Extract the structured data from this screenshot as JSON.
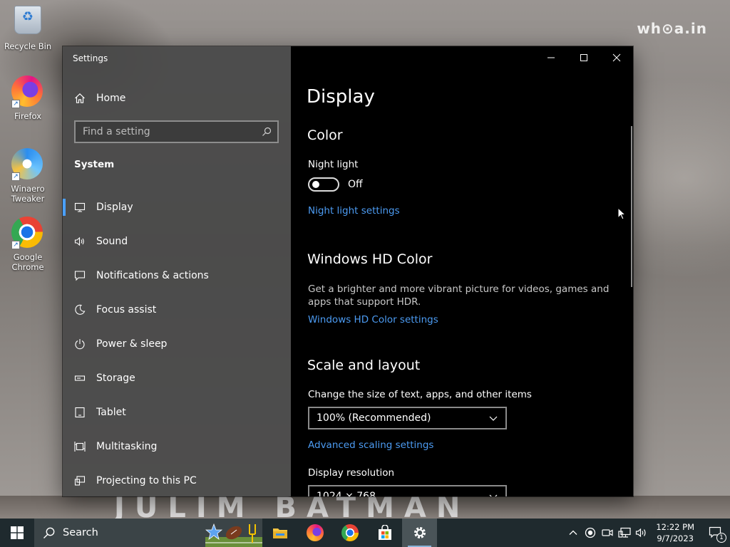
{
  "desktop": {
    "watermark": "wh⊙a.in",
    "wall_text": "JULIM BATMAN",
    "icons": [
      {
        "label": "Recycle Bin",
        "icon": "recycle-bin-icon"
      },
      {
        "label": "Firefox",
        "icon": "firefox-icon"
      },
      {
        "label": "Winaero Tweaker",
        "icon": "winaero-tweaker-icon"
      },
      {
        "label": "Google Chrome",
        "icon": "chrome-icon"
      }
    ]
  },
  "window": {
    "title": "Settings",
    "controls": {
      "minimize": "minimize-icon",
      "maximize": "maximize-icon",
      "close": "close-icon"
    }
  },
  "sidebar": {
    "home_label": "Home",
    "search_placeholder": "Find a setting",
    "section": "System",
    "items": [
      {
        "label": "Display",
        "icon": "display-icon",
        "selected": true
      },
      {
        "label": "Sound",
        "icon": "sound-icon"
      },
      {
        "label": "Notifications & actions",
        "icon": "notifications-icon"
      },
      {
        "label": "Focus assist",
        "icon": "focus-assist-icon"
      },
      {
        "label": "Power & sleep",
        "icon": "power-icon"
      },
      {
        "label": "Storage",
        "icon": "storage-icon"
      },
      {
        "label": "Tablet",
        "icon": "tablet-icon"
      },
      {
        "label": "Multitasking",
        "icon": "multitasking-icon"
      },
      {
        "label": "Projecting to this PC",
        "icon": "projecting-icon"
      }
    ]
  },
  "main": {
    "title": "Display",
    "color": {
      "heading": "Color",
      "night_light_label": "Night light",
      "night_light_state": "Off",
      "night_light_link": "Night light settings"
    },
    "hd_color": {
      "heading": "Windows HD Color",
      "description": "Get a brighter and more vibrant picture for videos, games and apps that support HDR.",
      "link": "Windows HD Color settings"
    },
    "scale": {
      "heading": "Scale and layout",
      "size_label": "Change the size of text, apps, and other items",
      "size_value": "100% (Recommended)",
      "advanced_link": "Advanced scaling settings",
      "resolution_label": "Display resolution",
      "resolution_value": "1024 × 768"
    }
  },
  "taskbar": {
    "search_label": "Search",
    "apps": [
      "file-explorer-icon",
      "firefox-icon",
      "chrome-icon",
      "store-icon",
      "settings-icon"
    ],
    "clock_time": "12:22 PM",
    "clock_date": "9/7/2023",
    "notification_count": "1"
  },
  "colors": {
    "accent": "#4aa0ff",
    "link": "#4c9bf2",
    "sidebar_bg": "#484848",
    "main_bg": "#000000",
    "taskbar_bg": "#1f2a2e"
  }
}
